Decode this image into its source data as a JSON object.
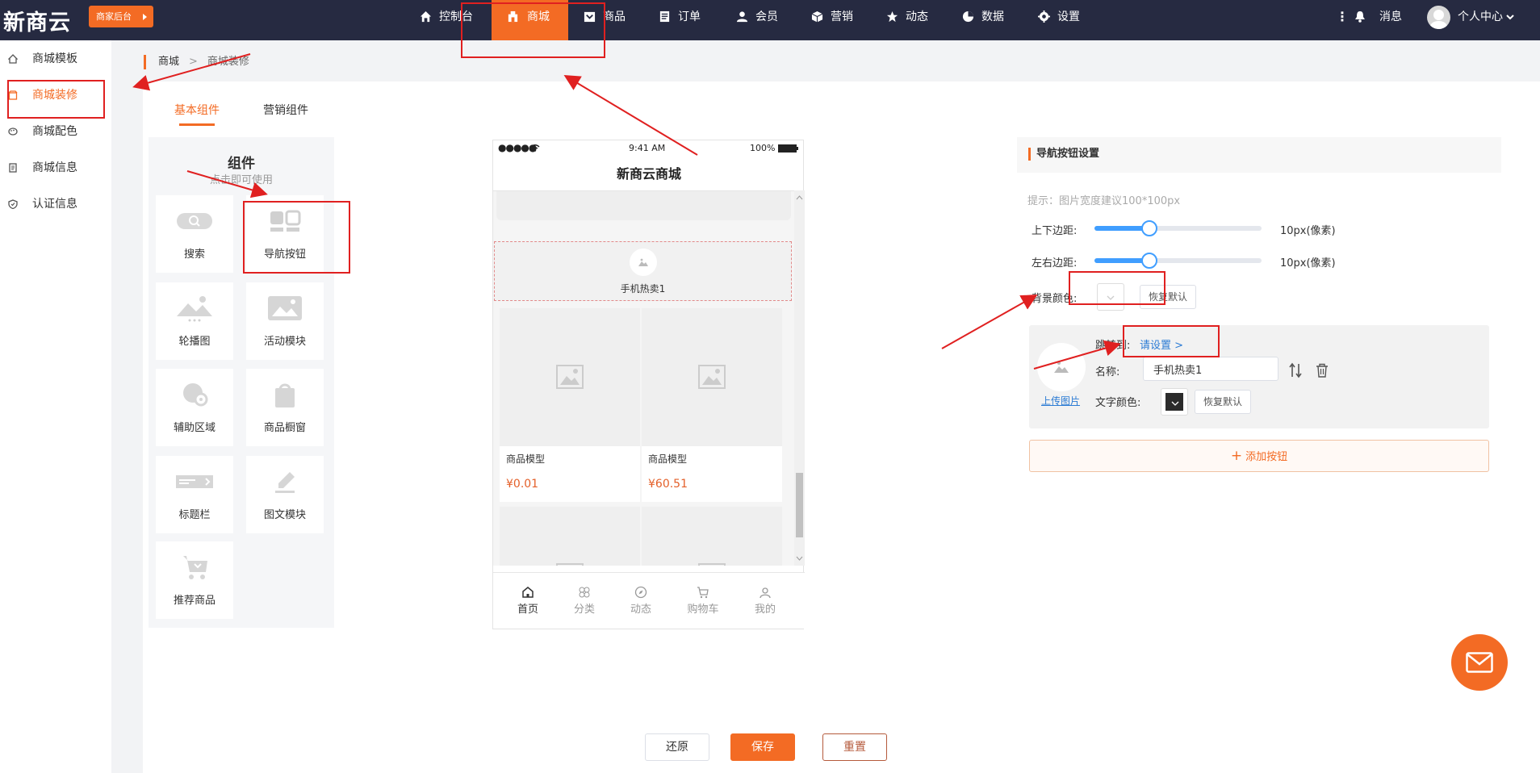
{
  "brand": {
    "logo": "新商云",
    "merchant_backend": "商家后台"
  },
  "top_nav": [
    {
      "label": "控制台",
      "icon": "home-icon"
    },
    {
      "label": "商城",
      "icon": "store-icon"
    },
    {
      "label": "商品",
      "icon": "product-icon"
    },
    {
      "label": "订单",
      "icon": "order-icon"
    },
    {
      "label": "会员",
      "icon": "member-icon"
    },
    {
      "label": "营销",
      "icon": "marketing-icon"
    },
    {
      "label": "动态",
      "icon": "star-icon"
    },
    {
      "label": "数据",
      "icon": "pie-chart-icon"
    },
    {
      "label": "设置",
      "icon": "gear-icon"
    }
  ],
  "top_right": {
    "messages": "消息",
    "personal_center": "个人中心"
  },
  "sidebar": {
    "items": [
      {
        "label": "商城模板"
      },
      {
        "label": "商城装修"
      },
      {
        "label": "商城配色"
      },
      {
        "label": "商城信息"
      },
      {
        "label": "认证信息"
      }
    ]
  },
  "breadcrumb": {
    "root": "商城",
    "separator": ">",
    "current": "商城装修"
  },
  "tabs": [
    {
      "label": "基本组件"
    },
    {
      "label": "营销组件"
    }
  ],
  "components": {
    "title": "组件",
    "subtitle": "点击即可使用",
    "items": [
      {
        "label": "搜索"
      },
      {
        "label": "导航按钮"
      },
      {
        "label": "轮播图"
      },
      {
        "label": "活动模块"
      },
      {
        "label": "辅助区域"
      },
      {
        "label": "商品橱窗"
      },
      {
        "label": "标题栏"
      },
      {
        "label": "图文模块"
      },
      {
        "label": "推荐商品"
      }
    ]
  },
  "phone": {
    "time": "9:41 AM",
    "battery": "100%",
    "title": "新商云商城",
    "hot_label": "手机热卖1",
    "products": [
      {
        "name": "商品模型",
        "price": "¥0.01"
      },
      {
        "name": "商品模型",
        "price": "¥60.51"
      }
    ],
    "tabbar": [
      {
        "label": "首页"
      },
      {
        "label": "分类"
      },
      {
        "label": "动态"
      },
      {
        "label": "购物车"
      },
      {
        "label": "我的"
      }
    ]
  },
  "settings": {
    "title": "导航按钮设置",
    "hint": "提示：图片宽度建议100*100px",
    "vertical_margin_label": "上下边距:",
    "vertical_margin_value": "10px(像素)",
    "vertical_margin_level": 0.33,
    "horizontal_margin_label": "左右边距:",
    "horizontal_margin_value": "10px(像素)",
    "horizontal_margin_level": 0.33,
    "bg_color_label": "背景颜色:",
    "reset_default": "恢复默认",
    "item": {
      "jump_label": "跳转到:",
      "jump_value": "请设置 >",
      "name_label": "名称:",
      "name_value": "手机热卖1",
      "text_color_label": "文字颜色:",
      "upload_label": "上传图片",
      "reset_default": "恢复默认"
    },
    "add_button": "添加按钮"
  },
  "footer": {
    "restore": "还原",
    "save": "保存",
    "reset": "重置"
  },
  "colors": {
    "accent": "#f36b24",
    "topbar": "#262a41",
    "link": "#2b7bd4",
    "annotation": "#e02020"
  }
}
